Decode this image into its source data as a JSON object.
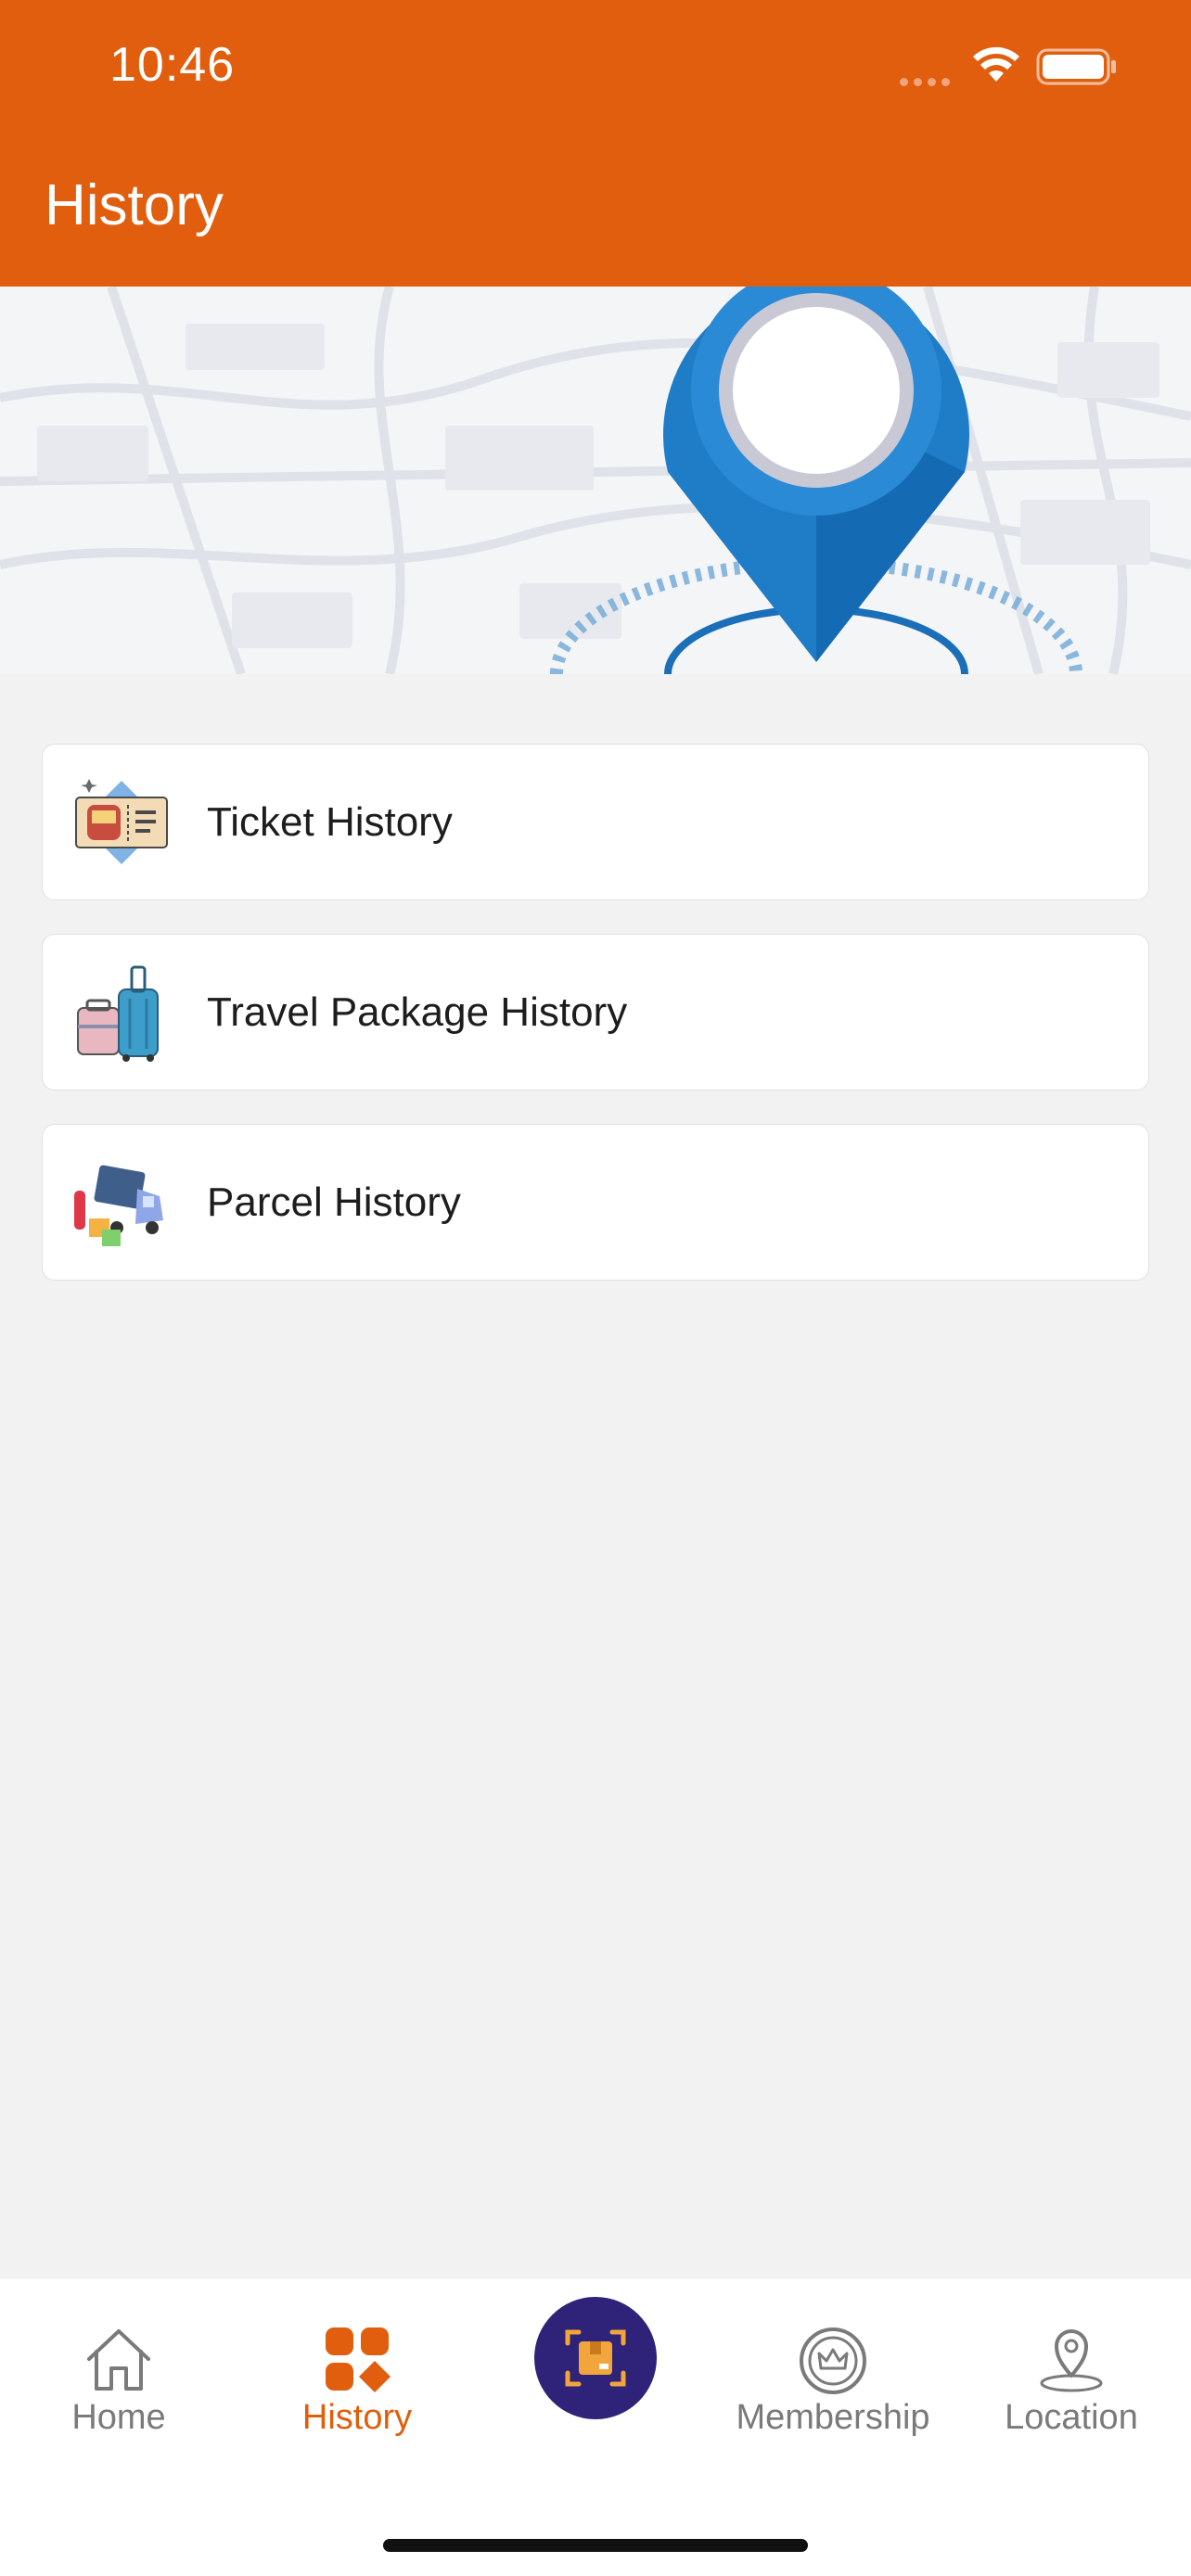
{
  "status_bar": {
    "time": "10:46"
  },
  "header": {
    "title": "History"
  },
  "history_items": [
    {
      "label": "Ticket History",
      "icon": "ticket-icon"
    },
    {
      "label": "Travel Package History",
      "icon": "luggage-icon"
    },
    {
      "label": "Parcel History",
      "icon": "delivery-truck-icon"
    }
  ],
  "tab_bar": {
    "home": "Home",
    "history": "History",
    "membership": "Membership",
    "location": "Location"
  },
  "colors": {
    "accent": "#e05e0d",
    "scan_button": "#2f2379",
    "background": "#f2f2f2"
  }
}
